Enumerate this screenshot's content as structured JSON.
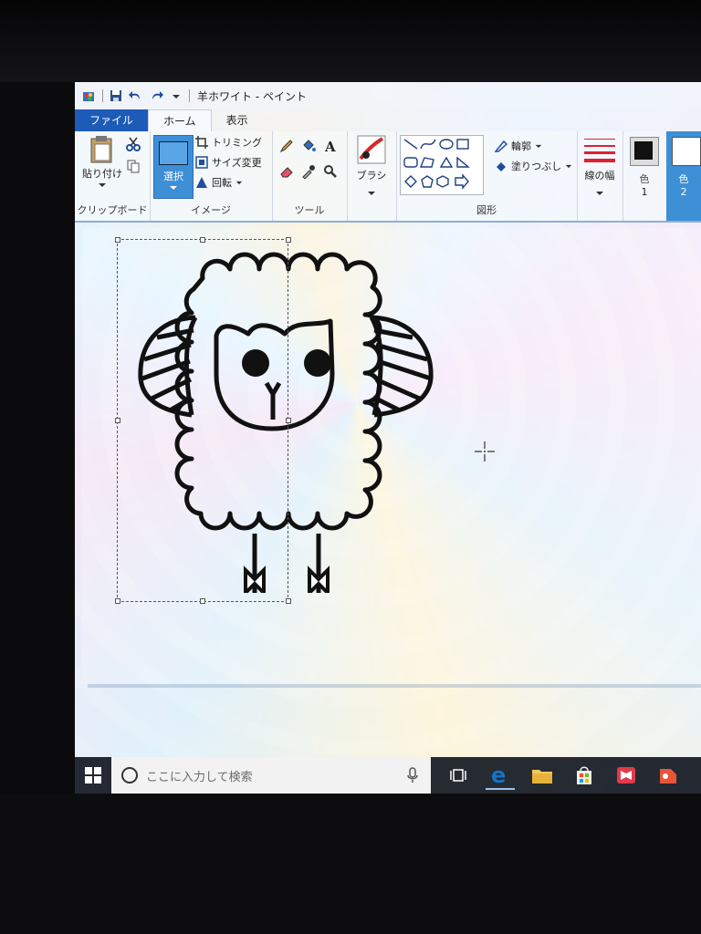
{
  "window": {
    "title": "羊ホワイト - ペイント"
  },
  "tabs": [
    {
      "label": "ファイル"
    },
    {
      "label": "ホーム"
    },
    {
      "label": "表示"
    }
  ],
  "ribbon": {
    "clipboard": {
      "paste": "貼り付け",
      "group": "クリップボード"
    },
    "image": {
      "select": "選択",
      "crop": "トリミング",
      "resize": "サイズ変更",
      "rotate": "回転",
      "group": "イメージ"
    },
    "tools": {
      "group": "ツール"
    },
    "brushes": {
      "label": "ブラシ"
    },
    "shapes": {
      "outline": "輪郭",
      "fill": "塗りつぶし",
      "group": "図形"
    },
    "size": {
      "label": "線の幅"
    },
    "color1": {
      "label": "色",
      "num": "1"
    },
    "color2": {
      "label": "色",
      "num": "2"
    }
  },
  "taskbar": {
    "search_placeholder": "ここに入力して検索"
  },
  "colors": {
    "file_tab": "#1e5bb8",
    "select_highlight": "#3d8fd6",
    "edge_blue": "#1572c9"
  }
}
